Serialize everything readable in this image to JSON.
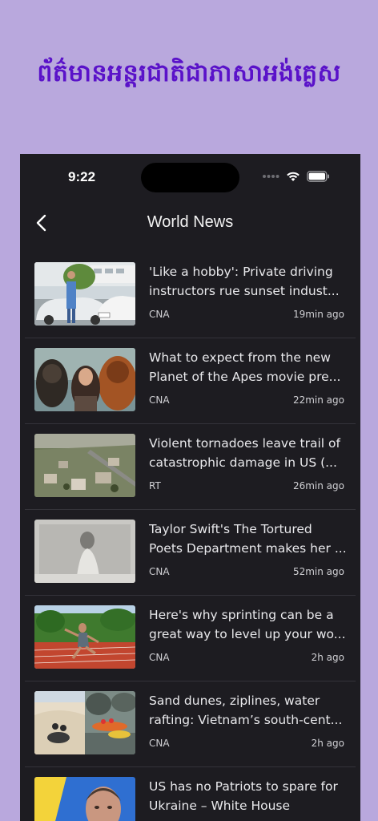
{
  "banner": {
    "title": "ព័ត៌មានអន្តរជាតិជាភាសាអង់គ្លេស"
  },
  "status_bar": {
    "time": "9:22"
  },
  "nav": {
    "title": "World News"
  },
  "articles": [
    {
      "title_line1": "'Like a hobby': Private driving",
      "title_line2": "instructors rue sunset indust...",
      "source": "CNA",
      "age": "19min ago"
    },
    {
      "title_line1": "What to expect from the new",
      "title_line2": "Planet of the Apes movie pre...",
      "source": "CNA",
      "age": "22min ago"
    },
    {
      "title_line1": "Violent tornadoes leave trail of",
      "title_line2": "catastrophic damage in US (...",
      "source": "RT",
      "age": "26min ago"
    },
    {
      "title_line1": "Taylor Swift's The Tortured",
      "title_line2": "Poets Department makes her ...",
      "source": "CNA",
      "age": "52min ago"
    },
    {
      "title_line1": "Here's why sprinting can be a",
      "title_line2": "great way to level up your wo...",
      "source": "CNA",
      "age": "2h ago"
    },
    {
      "title_line1": "Sand dunes, ziplines, water",
      "title_line2": "rafting: Vietnam’s south-cent...",
      "source": "CNA",
      "age": "2h ago"
    },
    {
      "title_line1": "US has no Patriots to spare for",
      "title_line2": "Ukraine – White House",
      "source": "",
      "age": ""
    }
  ]
}
